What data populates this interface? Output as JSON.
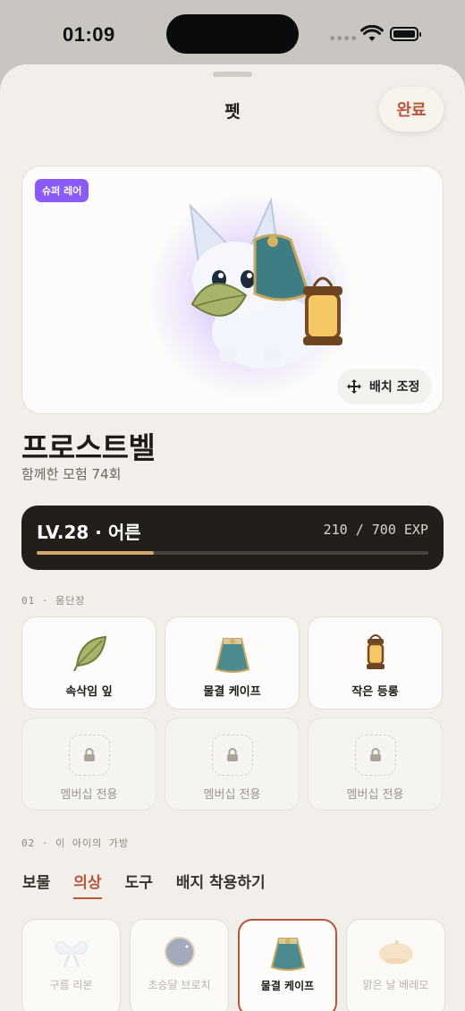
{
  "status": {
    "time": "01:09"
  },
  "header": {
    "title": "펫",
    "done_label": "완료"
  },
  "pet": {
    "rarity": "슈퍼 레어",
    "name": "프로스트벨",
    "subtitle": "함께한 모험 74회",
    "adjust_label": "배치 조정"
  },
  "level": {
    "label": "LV.28 · 어른",
    "exp_text": "210 / 700 EXP",
    "exp_current": 210,
    "exp_max": 700
  },
  "sections": {
    "equip": "01 · 몸단장",
    "bag": "02 · 이 아이의 가방"
  },
  "equip_slots": [
    {
      "label": "속삭임 잎",
      "icon": "leaf-icon",
      "locked": false
    },
    {
      "label": "물결 케이프",
      "icon": "cape-icon",
      "locked": false
    },
    {
      "label": "작은 등롱",
      "icon": "lantern-icon",
      "locked": false
    },
    {
      "label": "멤버십 전용",
      "icon": "lock-icon",
      "locked": true
    },
    {
      "label": "멤버십 전용",
      "icon": "lock-icon",
      "locked": true
    },
    {
      "label": "멤버십 전용",
      "icon": "lock-icon",
      "locked": true
    }
  ],
  "tabs": [
    {
      "label": "보물",
      "active": false
    },
    {
      "label": "의상",
      "active": true
    },
    {
      "label": "도구",
      "active": false
    },
    {
      "label": "배지 착용하기",
      "active": false
    }
  ],
  "inventory": [
    {
      "label": "구름 리본",
      "icon": "ribbon-icon",
      "selected": false
    },
    {
      "label": "초승달 브로치",
      "icon": "moon-brooch-icon",
      "selected": false
    },
    {
      "label": "물결 케이프",
      "icon": "cape-icon",
      "selected": true
    },
    {
      "label": "맑은 날 베레모",
      "icon": "beret-icon",
      "selected": false
    }
  ],
  "colors": {
    "accent": "#b5563b",
    "rarity": "#8a5cf5",
    "exp_bar": "#d3a86a",
    "level_bg": "#221e1a"
  }
}
